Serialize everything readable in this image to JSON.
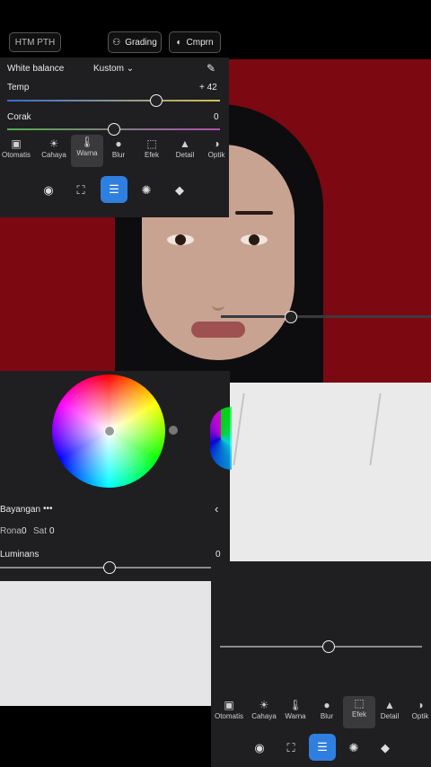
{
  "top_bar": {
    "left_button": "HTM PTH",
    "grading_label": "Grading",
    "compare_label": "Cmprn"
  },
  "white_balance": {
    "label": "White balance",
    "value": "Kustom",
    "temp_label": "Temp",
    "temp_value": "+ 42",
    "tint_label": "Corak",
    "tint_value": "0"
  },
  "tabs": [
    {
      "label": "Otomatis",
      "icon": "auto-icon"
    },
    {
      "label": "Cahaya",
      "icon": "light-icon"
    },
    {
      "label": "Warna",
      "icon": "color-icon"
    },
    {
      "label": "Blur",
      "icon": "blur-icon"
    },
    {
      "label": "Efek",
      "icon": "effects-icon"
    },
    {
      "label": "Detail",
      "icon": "detail-icon"
    },
    {
      "label": "Optik",
      "icon": "optics-icon"
    }
  ],
  "tools": [
    "heal-icon",
    "crop-icon",
    "adjust-icon",
    "mask-icon",
    "preset-icon"
  ],
  "grading": {
    "region_label": "Bayangan",
    "more": "•••",
    "hue_label": "Rona",
    "hue_value": "0",
    "sat_label": "Sat",
    "sat_value": "0",
    "lum_label": "Luminans",
    "lum_value": "0"
  },
  "colors": {
    "accent": "#2f7fe0",
    "panel": "#1f1f21",
    "backdrop": "#7c0812"
  }
}
